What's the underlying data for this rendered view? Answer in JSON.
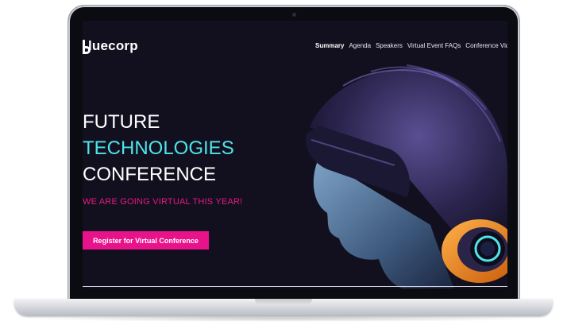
{
  "brand": {
    "logo_text": "luecorp"
  },
  "nav": {
    "items": [
      {
        "label": "Summary",
        "active": true
      },
      {
        "label": "Agenda",
        "active": false
      },
      {
        "label": "Speakers",
        "active": false
      },
      {
        "label": "Virtual Event FAQs",
        "active": false
      },
      {
        "label": "Conference Video",
        "active": false
      }
    ]
  },
  "hero": {
    "line1": "FUTURE",
    "line2": "TECHNOLOGIES",
    "line3": "CONFERENCE",
    "subtitle": "WE ARE GOING VIRTUAL THIS YEAR!",
    "cta_label": "Register for Virtual Conference"
  },
  "colors": {
    "background": "#12101f",
    "accent_cyan": "#4fe3ea",
    "accent_pink": "#e8128a",
    "accent_orange": "#f08a1e"
  }
}
